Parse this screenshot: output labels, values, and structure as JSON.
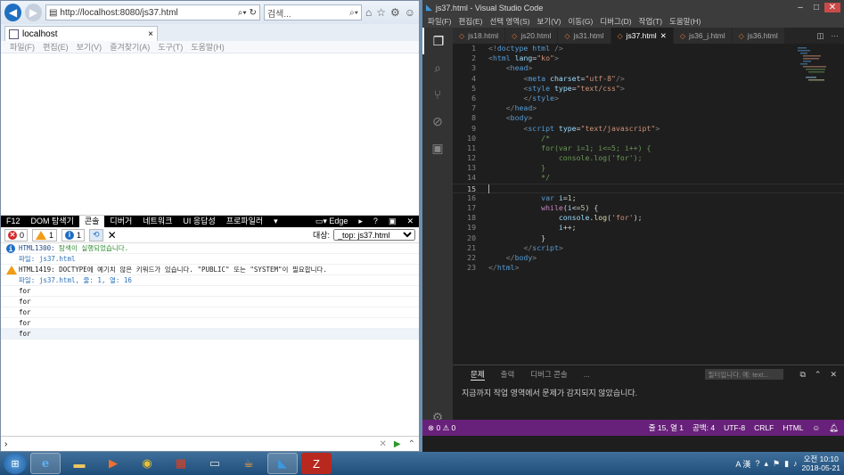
{
  "ie": {
    "url": "http://localhost:8080/js37.html",
    "search_placeholder": "검색...",
    "tab_title": "localhost",
    "menu": [
      "파일(F)",
      "편집(E)",
      "보기(V)",
      "즐겨찾기(A)",
      "도구(T)",
      "도움말(H)"
    ]
  },
  "f12": {
    "tabs": [
      "F12",
      "DOM 탐색기",
      "콘솔",
      "디버거",
      "네트워크",
      "UI 응답성",
      "프로파일러"
    ],
    "emulation_label": "Edge",
    "error_count": "0",
    "warning_count": "1",
    "info_count": "1",
    "target_label": "대상:",
    "target_value": "_top: js37.html",
    "console": {
      "info_code": "HTML1300: ",
      "info_text": "탐색이 실행되었습니다.",
      "info_file": "파일: js37.html",
      "warn_text": "HTML1419: DOCTYPE에 예기치 않은 키워드가 있습니다. \"PUBLIC\" 또는 \"SYSTEM\"이 필요합니다.",
      "warn_file": "파일: js37.html, 줄: 1, 열: 16",
      "outputs": [
        "for",
        "for",
        "for",
        "for",
        "for"
      ]
    }
  },
  "vscode": {
    "title": "js37.html - Visual Studio Code",
    "menu": [
      "파일(F)",
      "편집(E)",
      "선택 영역(S)",
      "보기(V)",
      "이동(G)",
      "디버그(D)",
      "작업(T)",
      "도움말(H)"
    ],
    "tabs": [
      "js18.html",
      "js20.html",
      "js31.html",
      "js37.html",
      "js36_j.html",
      "js36.html"
    ],
    "active_tab": "js37.html",
    "panel_tabs": [
      "문제",
      "출력",
      "디버그 콘솔",
      "..."
    ],
    "panel_filter": "필터입니다. 예: text...",
    "panel_message": "지금까지 작업 영역에서 문제가 감지되지 않았습니다.",
    "status": {
      "problems": "⊗ 0 ⚠ 0",
      "position": "줄 15, 열 1",
      "spaces": "공백: 4",
      "encoding": "UTF-8",
      "eol": "CRLF",
      "language": "HTML"
    },
    "code_lines": [
      "1",
      "2",
      "3",
      "4",
      "5",
      "6",
      "7",
      "8",
      "9",
      "10",
      "11",
      "12",
      "13",
      "14",
      "15",
      "16",
      "17",
      "18",
      "19",
      "20",
      "21",
      "22",
      "23"
    ]
  },
  "taskbar": {
    "ime": "A 漢",
    "time": "오전 10:10",
    "date": "2018-05-21"
  },
  "colors": {
    "vscode_status": "#68217a",
    "ie_back": "#1e6fc2"
  }
}
